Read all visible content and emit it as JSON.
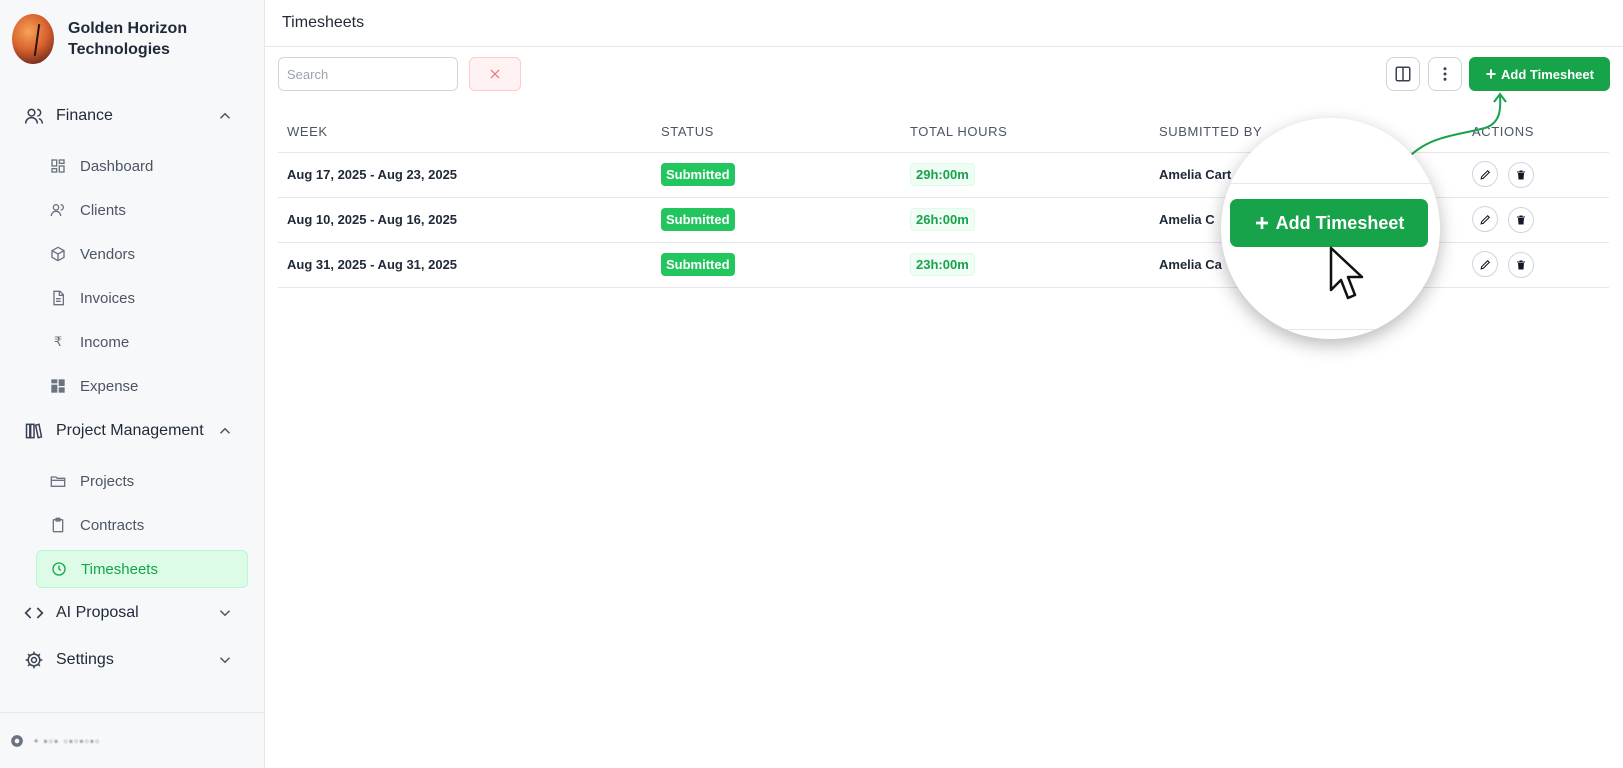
{
  "brand": {
    "name": "Golden Horizon Technologies"
  },
  "sidebar": {
    "sections": [
      {
        "label": "Finance",
        "icon": "users-icon",
        "expanded": true
      },
      {
        "label": "Project Management",
        "icon": "books-icon",
        "expanded": true
      },
      {
        "label": "AI Proposal",
        "icon": "code-icon",
        "expanded": false
      },
      {
        "label": "Settings",
        "icon": "gear-icon",
        "expanded": false
      }
    ],
    "items": [
      {
        "label": "Dashboard",
        "icon": "dashboard-icon"
      },
      {
        "label": "Clients",
        "icon": "users-icon"
      },
      {
        "label": "Vendors",
        "icon": "cube-icon"
      },
      {
        "label": "Invoices",
        "icon": "document-icon"
      },
      {
        "label": "Income",
        "icon": "rupee-icon",
        "glyph": "₹"
      },
      {
        "label": "Expense",
        "icon": "grid-icon"
      },
      {
        "label": "Projects",
        "icon": "folder-icon"
      },
      {
        "label": "Contracts",
        "icon": "clipboard-icon"
      },
      {
        "label": "Timesheets",
        "icon": "clock-icon",
        "active": true
      }
    ],
    "footer_text": "• ▪▫▪ ▫▪▫▪▫▪▫"
  },
  "header": {
    "title": "Timesheets"
  },
  "toolbar": {
    "search_placeholder": "Search",
    "add_label": "Add Timesheet"
  },
  "table": {
    "columns": [
      "WEEK",
      "STATUS",
      "TOTAL HOURS",
      "SUBMITTED BY",
      "ACTIONS"
    ],
    "rows": [
      {
        "week": "Aug 17, 2025 - Aug 23, 2025",
        "status": "Submitted",
        "hours": "29h:00m",
        "submitted_by": "Amelia Cart"
      },
      {
        "week": "Aug 10, 2025 - Aug 16, 2025",
        "status": "Submitted",
        "hours": "26h:00m",
        "submitted_by": "Amelia C"
      },
      {
        "week": "Aug 31, 2025 - Aug 31, 2025",
        "status": "Submitted",
        "hours": "23h:00m",
        "submitted_by": "Amelia Ca"
      }
    ]
  },
  "callout": {
    "label": "Add Timesheet"
  },
  "colors": {
    "accent": "#16a34a",
    "badge": "#22c55e",
    "active_bg": "#dcfce7"
  }
}
